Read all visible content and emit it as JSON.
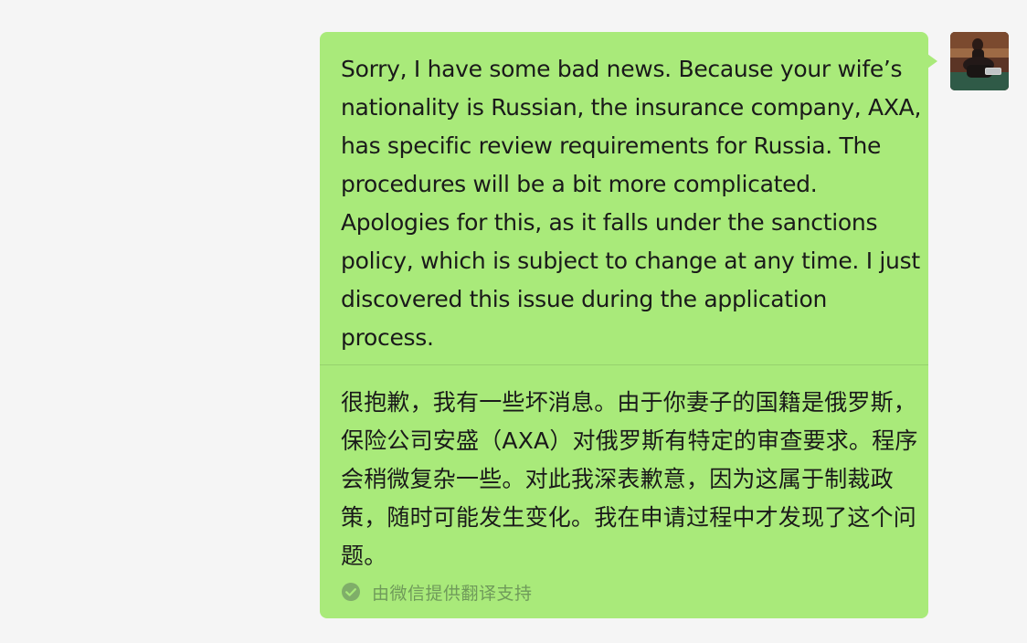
{
  "message": {
    "original_text": "Sorry, I have some bad news. Because your wife’s nationality is Russian, the insurance company, AXA, has specific review requirements for Russia. The procedures will be a bit more complicated. Apologies for this, as it falls under the sanctions policy, which is subject to change at any time. I just discovered this issue during the application process.",
    "translated_text": "很抱歉，我有一些坏消息。由于你妻子的国籍是俄罗斯，保险公司安盛（AXA）对俄罗斯有特定的审查要求。程序会稍微复杂一些。对此我深表歉意，因为这属于制裁政策，随时可能发生变化。我在申请过程中才发现了这个问题。",
    "translation_credit": "由微信提供翻译支持",
    "credit_icon": "check-circle-icon",
    "avatar_icon": "user-avatar-icon"
  },
  "colors": {
    "background": "#f5f5f5",
    "bubble": "#a9ea7a",
    "text": "#1a1a1a",
    "credit_text": "#6f9a5a"
  }
}
